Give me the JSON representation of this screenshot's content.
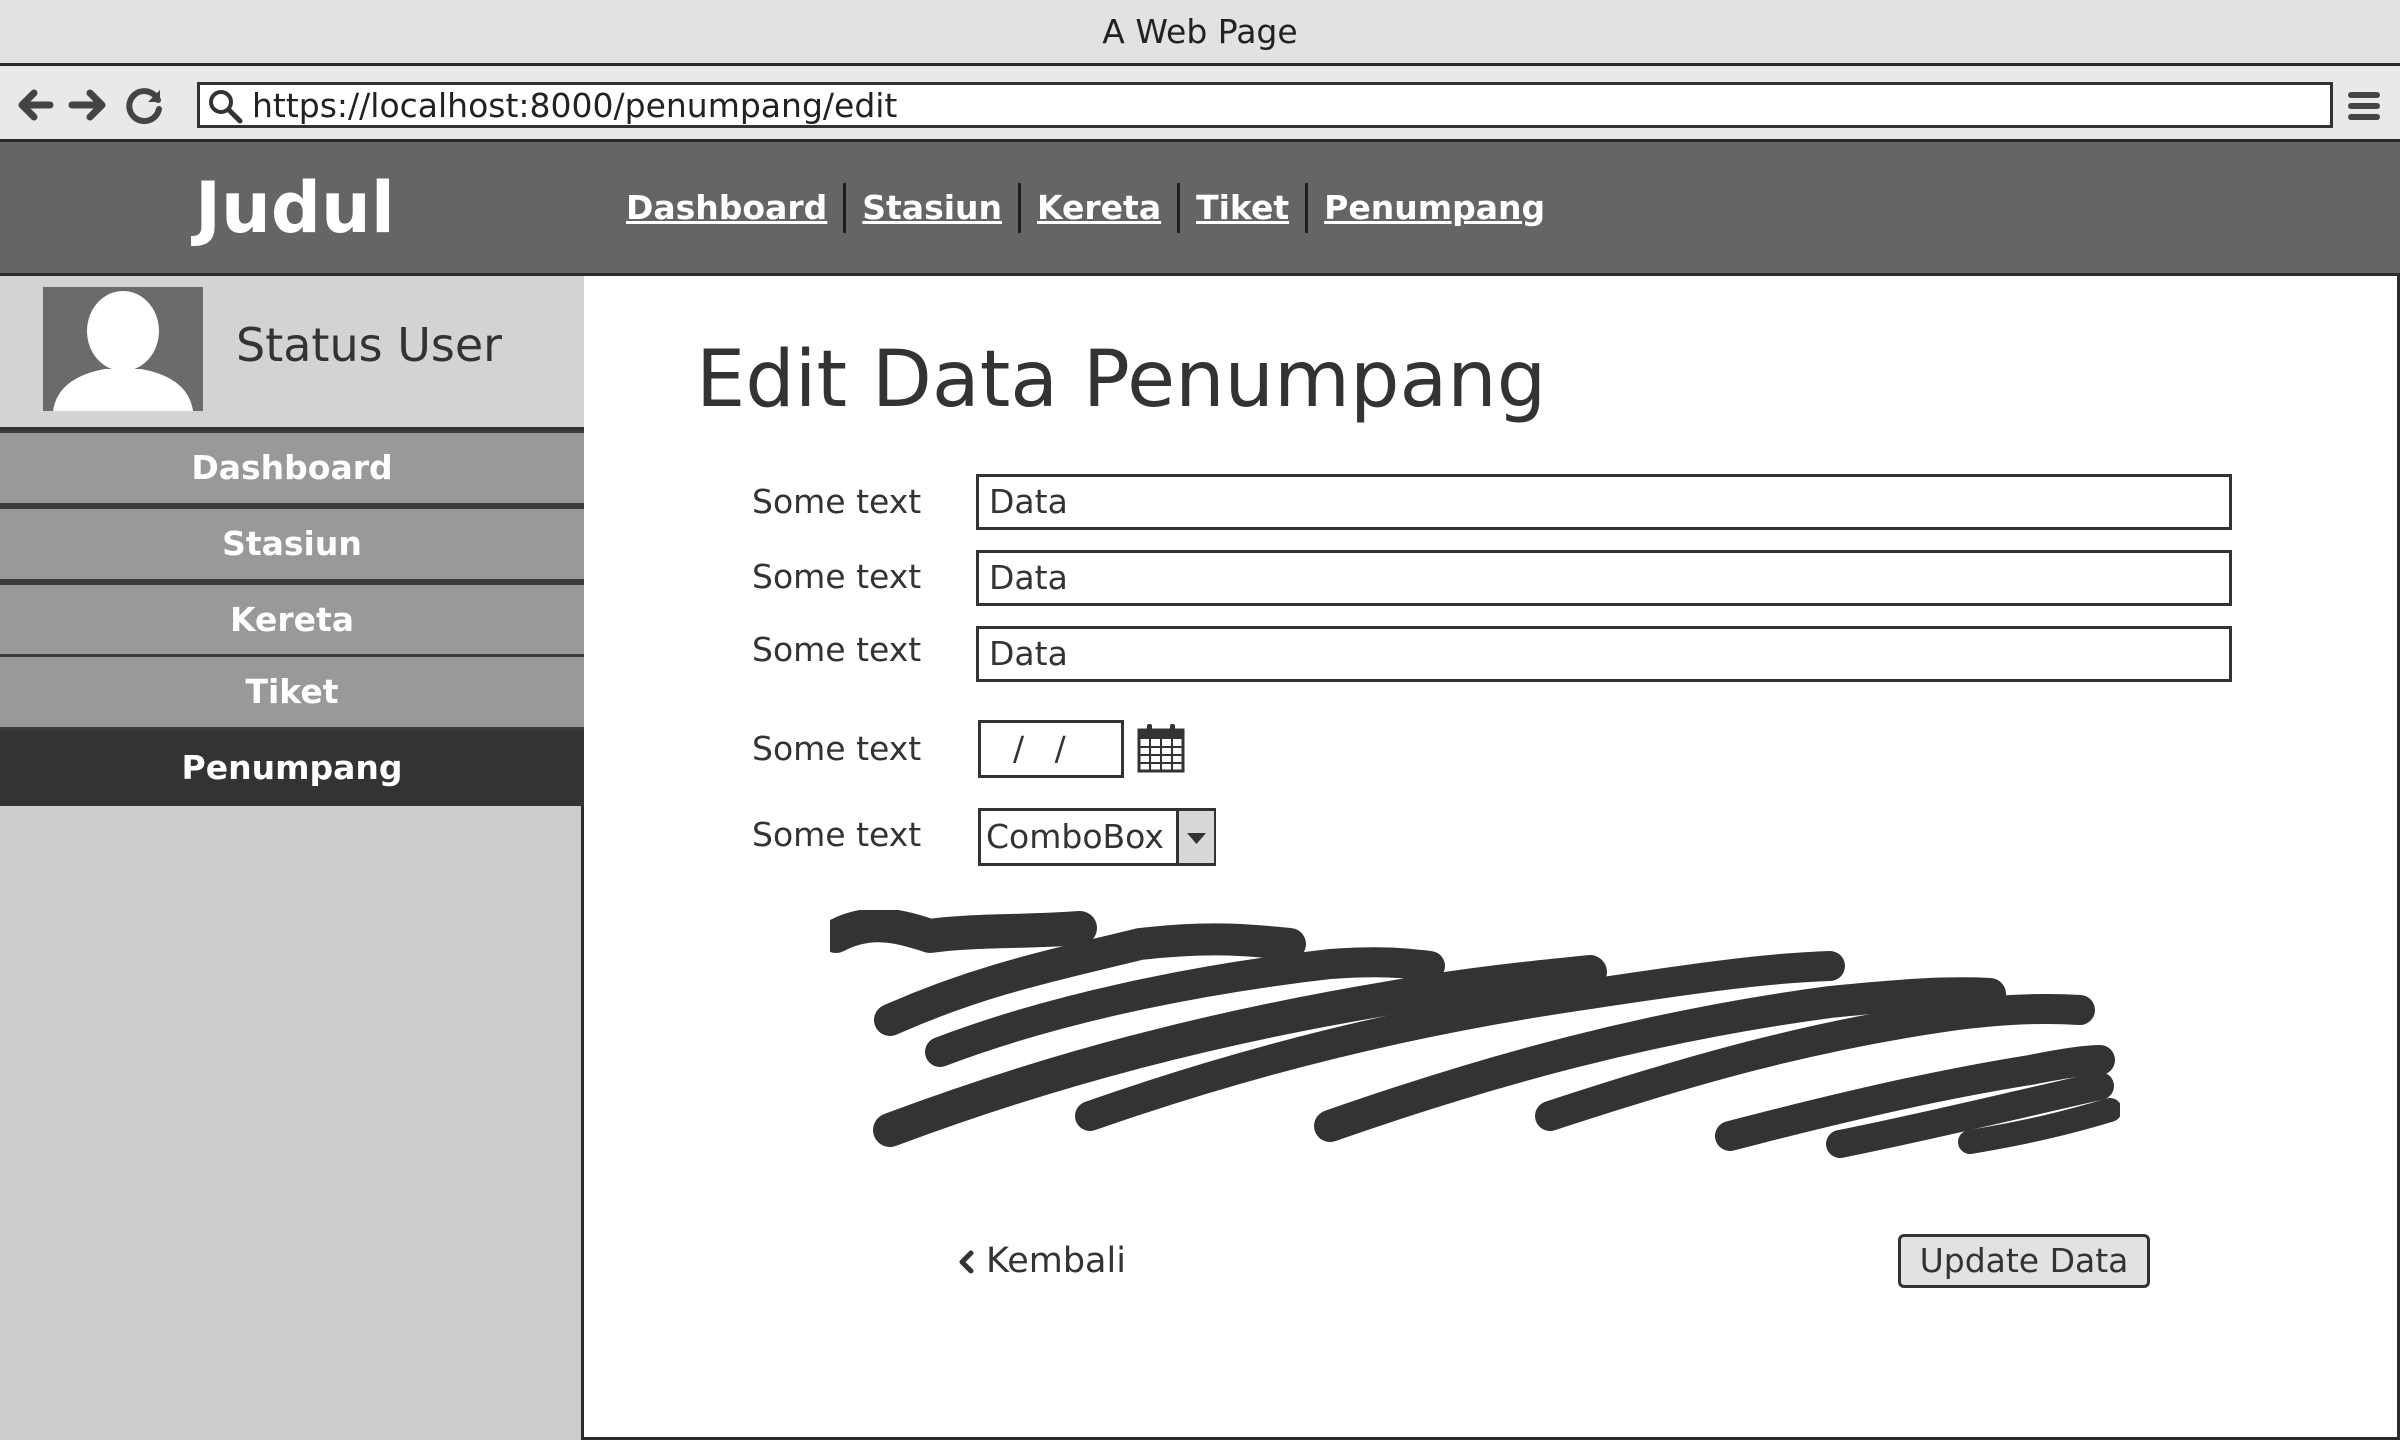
{
  "window": {
    "title": "A Web Page"
  },
  "browser": {
    "url": "https://localhost:8000/penumpang/edit",
    "icons": [
      "back-arrow-icon",
      "forward-arrow-icon",
      "reload-icon",
      "search-icon",
      "hamburger-menu-icon"
    ]
  },
  "header": {
    "logo": "Judul",
    "nav": [
      "Dashboard",
      "Stasiun",
      "Kereta",
      "Tiket",
      "Penumpang"
    ]
  },
  "sidebar": {
    "user_status": "Status User",
    "items": [
      {
        "label": "Dashboard",
        "active": false
      },
      {
        "label": "Stasiun",
        "active": false
      },
      {
        "label": "Kereta",
        "active": false
      },
      {
        "label": "Tiket",
        "active": false
      },
      {
        "label": "Penumpang",
        "active": true
      }
    ]
  },
  "form": {
    "title": "Edit Data Penumpang",
    "fields": [
      {
        "label": "Some text",
        "value": "Data"
      },
      {
        "label": "Some text",
        "value": "Data"
      },
      {
        "label": "Some text",
        "value": "Data"
      }
    ],
    "date_field": {
      "label": "Some text",
      "value": "/ /"
    },
    "combo_field": {
      "label": "Some text",
      "value": "ComboBox"
    },
    "back_label": "Kembali",
    "submit_label": "Update Data"
  },
  "colors": {
    "header_bg": "#656565",
    "sidebar_bg": "#cccccc",
    "sidebar_item_bg": "#999999",
    "sidebar_active_bg": "#333333"
  }
}
